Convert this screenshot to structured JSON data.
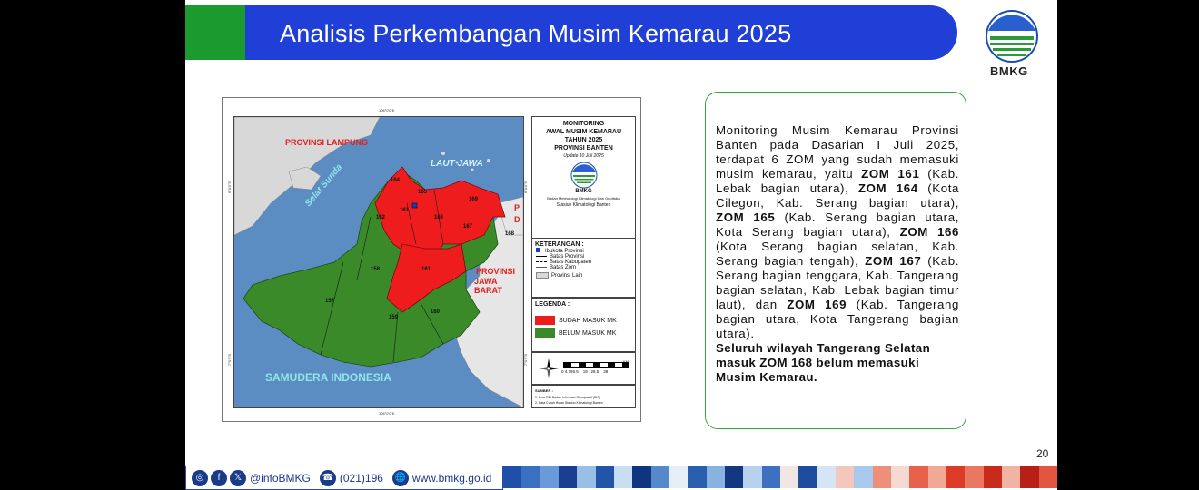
{
  "header": {
    "title": "Analisis Perkembangan Musim Kemarau 2025",
    "logo_text": "BMKG"
  },
  "map": {
    "coord_top": "106°0'0\"E",
    "coord_bottom": "106°0'0\"E",
    "coord_left_1": "6°0'0\"S",
    "coord_left_2": "7°0'0\"S",
    "coord_right_1": "6°0'0\"S",
    "coord_right_2": "7°0'0\"S",
    "labels": {
      "lampung": "PROVINSI LAMPUNG",
      "laut_jawa": "LAUT JAWA",
      "selat_sunda": "Selat Sunda",
      "jawa_barat_1": "PROVINSI",
      "jawa_barat_2": "JAWA BARAT",
      "samudera": "SAMUDERA INDONESIA",
      "dki_1": "P",
      "dki_2": "D"
    },
    "zones": {
      "z157": "157",
      "z158": "158",
      "z159": "159",
      "z160": "160",
      "z161": "161",
      "z162": "162",
      "z164": "164",
      "z165": "165",
      "z166": "166",
      "z167": "167",
      "z168": "168",
      "z169": "169",
      "z161b": "161"
    },
    "panel_title": {
      "line1": "MONITORING",
      "line2": "AWAL MUSIM KEMARAU",
      "line3": "TAHUN 2025",
      "line4": "PROVINSI BANTEN",
      "update": "Update 10 Juli 2025",
      "logo": "BMKG",
      "org1": "Badan Meteorologi Klimatologi Dan Geofisika",
      "org2": "Stasiun Klimatologi Banten"
    },
    "keterangan": {
      "title": "KETERANGAN :",
      "items": [
        "Ibukota Provinsi",
        "Batas Provinsi",
        "Batas Kabupaten",
        "Batas Zom",
        "Provinsi Lain"
      ]
    },
    "legenda": {
      "title": "LEGENDA :",
      "sudah": "SUDAH MASUK MK",
      "belum": "BELUM MASUK MK",
      "red": "#ee1c1c",
      "green": "#3a8a2a"
    },
    "scale": {
      "ticks": "0 4.759.5    19   28.5    38",
      "unit": "KM"
    },
    "sumber": {
      "title": "SUMBER :",
      "s1": "1. Peta RBI Badan Informasi Geospasial (BIG)",
      "s2": "2. Data Curah Hujan Stasiun Klimatologi Banten"
    }
  },
  "textbox": {
    "intro": "Monitoring Musim Kemarau Provinsi Banten pada  Dasarian I Juli 2025, terdapat 6 ZOM yang sudah memasuki musim kemarau, yaitu ",
    "z161": "ZOM 161",
    "t161": " (Kab. Lebak bagian utara), ",
    "z164": "ZOM 164",
    "t164": " (Kota Cilegon, Kab. Serang bagian utara), ",
    "z165": "ZOM 165",
    "t165": " (Kab. Serang bagian utara, Kota Serang bagian utara), ",
    "z166": "ZOM 166",
    "t166": " (Kota Serang bagian selatan, Kab. Serang bagian tengah), ",
    "z167": "ZOM 167",
    "t167": " (Kab. Serang bagian tenggara, Kab. Tangerang bagian selatan, Kab. Lebak bagian timur laut), dan ",
    "z169": "ZOM 169",
    "t169": " (Kab. Tangerang bagian utara, Kota Tangerang bagian utara).",
    "closing": "Seluruh wilayah Tangerang Selatan masuk ZOM 168 belum memasuki Musim Kemarau."
  },
  "page_number": "20",
  "footer": {
    "handle": "@infoBMKG",
    "phone": "(021)196",
    "website": "www.bmkg.go.id",
    "icons": [
      "instagram-icon",
      "facebook-icon",
      "x-icon",
      "phone-icon",
      "globe-icon"
    ],
    "stripe_colors": [
      "#1f4fa8",
      "#3b6fc0",
      "#6a9bd8",
      "#1a3f90",
      "#98bfe6",
      "#2255a8",
      "#c9def3",
      "#0f3580",
      "#5589cc",
      "#e6eef8",
      "#2a5fb0",
      "#88b2e0",
      "#13387f",
      "#b6d2ef",
      "#3c70c0",
      "#f2e6e3",
      "#1e4c9e",
      "#d6e5f5",
      "#f3c7bc",
      "#a8c9ec",
      "#ee8f7a",
      "#f6d9d2",
      "#e8624b",
      "#f0a995",
      "#dc3b27",
      "#e97762",
      "#c82a1c",
      "#f1b3a2",
      "#b81f16",
      "#e25541"
    ]
  }
}
